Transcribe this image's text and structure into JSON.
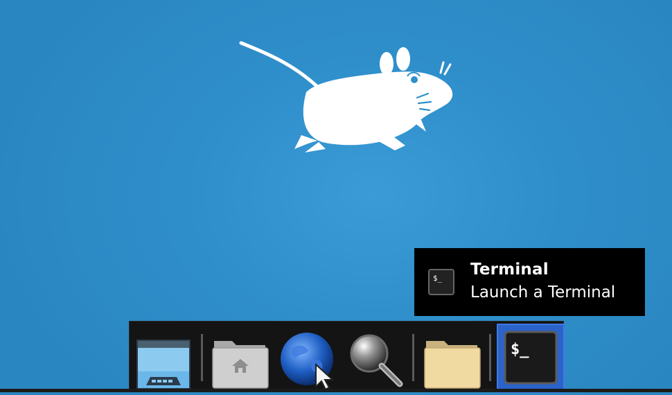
{
  "desktop": {
    "background_color": "#2f8fcb",
    "mascot_icon": "xfce-mouse-icon"
  },
  "tooltip": {
    "title": "Terminal",
    "subtitle": "Launch a Terminal",
    "icon": "terminal-icon",
    "prompt_glyph": "$_"
  },
  "dock": {
    "items": [
      {
        "name": "show-desktop",
        "icon": "desktop-icon"
      },
      {
        "name": "home-folder",
        "icon": "home-folder-icon"
      },
      {
        "name": "web-browser",
        "icon": "globe-icon"
      },
      {
        "name": "app-finder",
        "icon": "magnifier-icon"
      },
      {
        "name": "file-manager",
        "icon": "folder-icon"
      },
      {
        "name": "terminal",
        "icon": "terminal-icon",
        "glyph": "$_",
        "active": true
      }
    ],
    "active_color": "#2b63c9"
  }
}
